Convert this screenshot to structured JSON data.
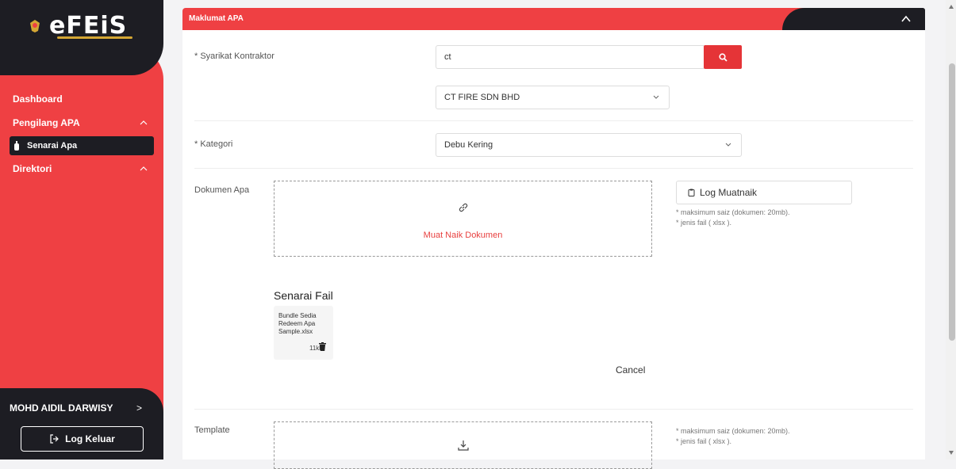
{
  "app": {
    "logo_text": "eFEiS"
  },
  "sidebar": {
    "items": [
      {
        "label": "Dashboard"
      },
      {
        "label": "Pengilang APA"
      },
      {
        "label": "Senarai Apa"
      },
      {
        "label": "Direktori"
      }
    ],
    "user_name": "MOHD AIDIL DARWISY",
    "user_arrow": ">",
    "logout_label": "Log Keluar"
  },
  "section": {
    "title": "Maklumat APA"
  },
  "form": {
    "contractor_label": "* Syarikat Kontraktor",
    "contractor_search_value": "ct",
    "contractor_selected": "CT FIRE SDN BHD",
    "category_label": "* Kategori",
    "category_selected": "Debu Kering",
    "document_label": "Dokumen Apa",
    "upload_label": "Muat Naik Dokumen",
    "log_button": "Log Muatnaik",
    "hint_size": "* maksimum saiz (dokumen: 20mb).",
    "hint_type": "* jenis fail ( xlsx ).",
    "files_title": "Senarai Fail",
    "files": [
      {
        "name": "Bundle Sedia Redeem Apa Sample.xlsx",
        "size": "11kb"
      }
    ],
    "cancel_label": "Cancel",
    "template_label": "Template",
    "template_hint_size": "* maksimum saiz (dokumen: 20mb).",
    "template_hint_type": "* jenis fail ( xlsx )."
  },
  "colors": {
    "brand_red": "#ef4043",
    "dark": "#1d1d23"
  },
  "icons": [
    "search-icon",
    "link-icon",
    "download-icon",
    "trash-icon",
    "clipboard-icon",
    "logout-icon",
    "chevron-up-icon",
    "chevron-down-icon"
  ]
}
